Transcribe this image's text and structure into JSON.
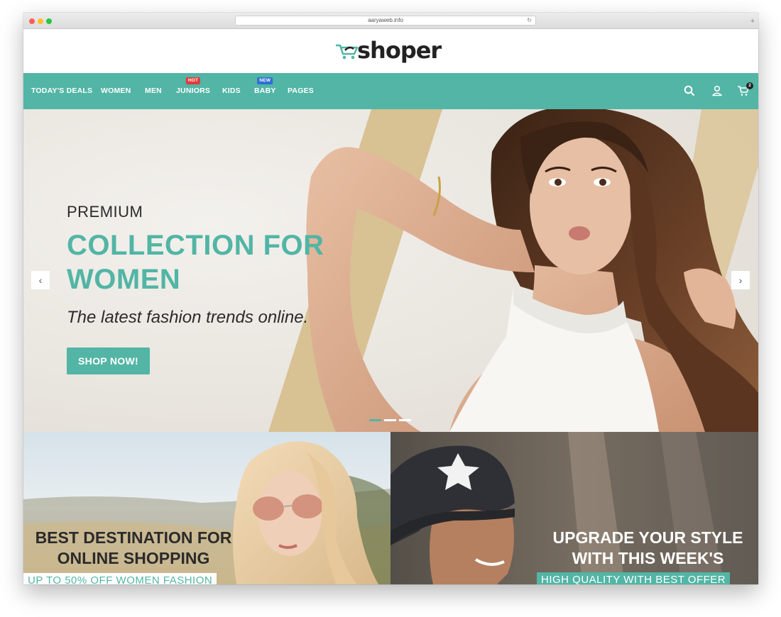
{
  "browser": {
    "url": "aaryaweb.info"
  },
  "header": {
    "logo_text": "shoper"
  },
  "nav": {
    "items": [
      {
        "label": "TODAY'S DEALS"
      },
      {
        "label": "WOMEN"
      },
      {
        "label": "MEN"
      },
      {
        "label": "JUNIORS",
        "badge": "HOT"
      },
      {
        "label": "KIDS"
      },
      {
        "label": "BABY",
        "badge": "NEW"
      },
      {
        "label": "PAGES"
      }
    ],
    "icons": [
      "search-icon",
      "user-icon",
      "cart-icon"
    ],
    "cart_count": "2"
  },
  "hero": {
    "pretitle": "PREMIUM",
    "title": "COLLECTION FOR WOMEN",
    "subtitle": "The latest fashion trends online.",
    "button": "SHOP NOW!",
    "slides_total": 3,
    "active_slide": 1
  },
  "promos": [
    {
      "title": "BEST DESTINATION FOR ONLINE SHOPPING",
      "strip": "UP TO 50% OFF WOMEN FASHION"
    },
    {
      "title": "UPGRADE YOUR STYLE WITH THIS WEEK'S",
      "strip": "HIGH QUALITY WITH BEST OFFER"
    }
  ],
  "colors": {
    "accent": "#52b5a5",
    "badge_hot": "#e23b3b",
    "badge_new": "#2f6fd6"
  }
}
